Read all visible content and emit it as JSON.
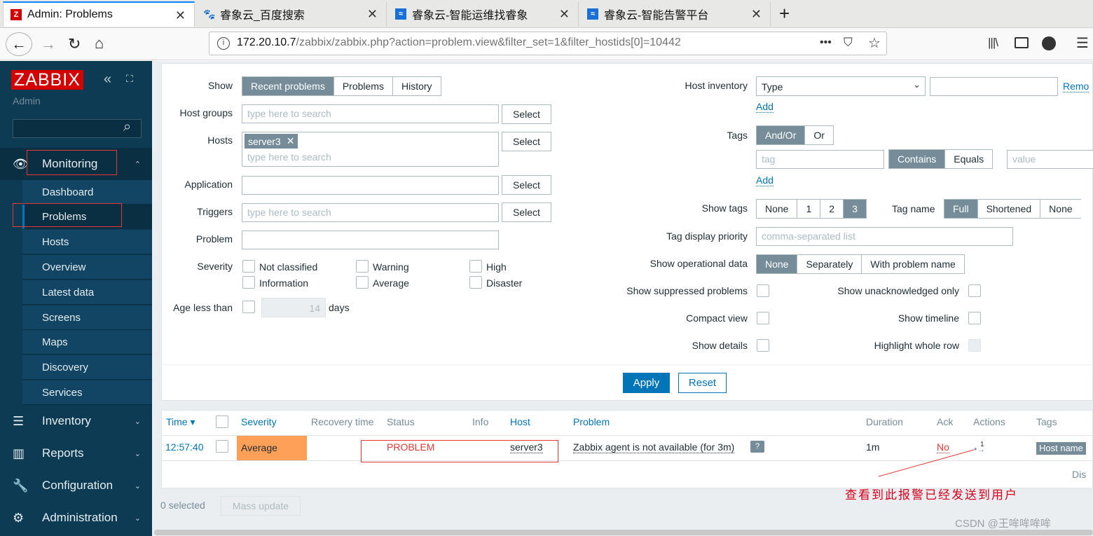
{
  "browser": {
    "tabs": [
      {
        "title": "Admin: Problems",
        "icon": "zabbix-z"
      },
      {
        "title": "睿象云_百度搜索",
        "icon": "baidu-paw"
      },
      {
        "title": "睿象云-智能运维找睿象",
        "icon": "ruixiang-logo"
      },
      {
        "title": "睿象云-智能告警平台",
        "icon": "ruixiang-logo"
      }
    ],
    "url_host": "172.20.10.7",
    "url_path": "/zabbix/zabbix.php?action=problem.view&filter_set=1&filter_hostids[0]=10442",
    "url_more": "•••"
  },
  "sidebar": {
    "logo": "ZABBIX",
    "user": "Admin",
    "collapse": "«",
    "kiosk": "⛶",
    "search_icon": "⌕",
    "monitoring": "Monitoring",
    "monitoring_items": [
      "Dashboard",
      "Problems",
      "Hosts",
      "Overview",
      "Latest data",
      "Screens",
      "Maps",
      "Discovery",
      "Services"
    ],
    "inventory": "Inventory",
    "reports": "Reports",
    "configuration": "Configuration",
    "administration": "Administration"
  },
  "filter": {
    "show_label": "Show",
    "show_options": [
      "Recent problems",
      "Problems",
      "History"
    ],
    "host_groups_label": "Host groups",
    "host_groups_placeholder": "type here to search",
    "hosts_label": "Hosts",
    "host_tag": "server3",
    "hosts_placeholder": "type here to search",
    "application_label": "Application",
    "triggers_label": "Triggers",
    "triggers_placeholder": "type here to search",
    "problem_label": "Problem",
    "severity_label": "Severity",
    "severities": [
      "Not classified",
      "Warning",
      "High",
      "Information",
      "Average",
      "Disaster"
    ],
    "age_label": "Age less than",
    "age_value": "14",
    "age_unit": "days",
    "select": "Select",
    "host_inventory_label": "Host inventory",
    "inventory_type": "Type",
    "remove": "Remo",
    "add": "Add",
    "tags_label": "Tags",
    "tags_options": [
      "And/Or",
      "Or"
    ],
    "tag_placeholder": "tag",
    "tag_ops": [
      "Contains",
      "Equals"
    ],
    "value_placeholder": "value",
    "show_tags_label": "Show tags",
    "show_tags_options": [
      "None",
      "1",
      "2",
      "3"
    ],
    "tag_name_label": "Tag name",
    "tag_name_options": [
      "Full",
      "Shortened",
      "None"
    ],
    "tag_priority_label": "Tag display priority",
    "tag_priority_placeholder": "comma-separated list",
    "opdata_label": "Show operational data",
    "opdata_options": [
      "None",
      "Separately",
      "With problem name"
    ],
    "suppressed_label": "Show suppressed problems",
    "unack_label": "Show unacknowledged only",
    "compact_label": "Compact view",
    "timeline_label": "Show timeline",
    "details_label": "Show details",
    "highlight_label": "Highlight whole row",
    "apply": "Apply",
    "reset": "Reset"
  },
  "table": {
    "headers": [
      "Time ▾",
      "Severity",
      "Recovery time",
      "Status",
      "Info",
      "Host",
      "Problem",
      "Duration",
      "Ack",
      "Actions",
      "Tags"
    ],
    "row": {
      "time": "12:57:40",
      "severity": "Average",
      "status": "PROBLEM",
      "host": "server3",
      "problem": "Zabbix agent is not available (for 3m)",
      "duration": "1m",
      "ack": "No",
      "actions_count": "1",
      "tag": "Host name"
    },
    "display_text": "Dis",
    "selected": "0 selected",
    "mass_update": "Mass update"
  },
  "annotation": "查看到此报警已经发送到用户",
  "watermark": "CSDN @王哞哞哞哞",
  "colors": {
    "sidebar": "#0e3b54",
    "accent": "#0275b8",
    "average": "#ffa059",
    "problem": "#e33734"
  }
}
